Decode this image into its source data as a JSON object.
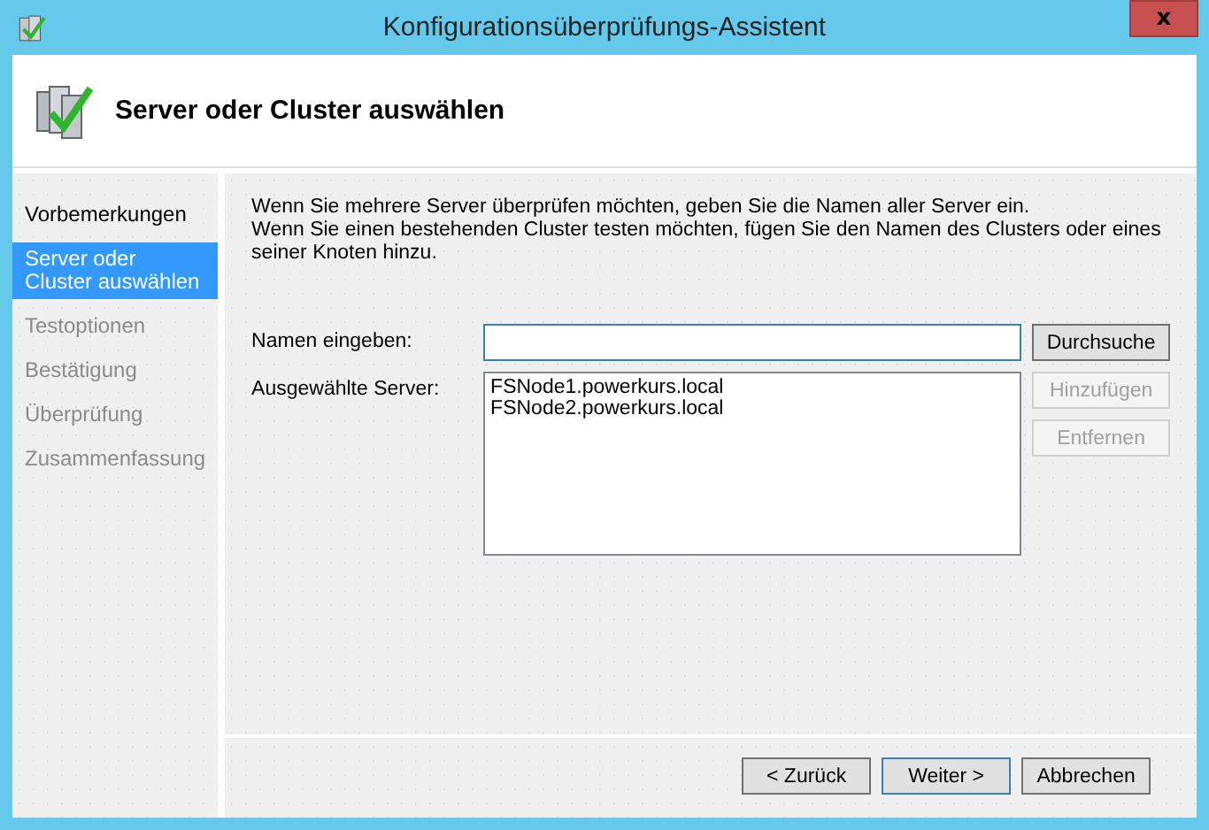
{
  "window": {
    "title": "Konfigurationsüberprüfungs-Assistent",
    "close": "x"
  },
  "header": {
    "title": "Server oder Cluster auswählen"
  },
  "nav": [
    {
      "label": "Vorbemerkungen",
      "selected": false,
      "disabled": false
    },
    {
      "label": "Server oder Cluster auswählen",
      "selected": true,
      "disabled": false
    },
    {
      "label": "Testoptionen",
      "selected": false,
      "disabled": true
    },
    {
      "label": "Bestätigung",
      "selected": false,
      "disabled": true
    },
    {
      "label": "Überprüfung",
      "selected": false,
      "disabled": true
    },
    {
      "label": "Zusammenfassung",
      "selected": false,
      "disabled": true
    }
  ],
  "intro": [
    "Wenn Sie mehrere Server überprüfen möchten, geben Sie die Namen aller Server ein.",
    "Wenn Sie einen bestehenden Cluster testen möchten, fügen Sie den Namen des Clusters oder eines seiner Knoten hinzu."
  ],
  "name_label": "Namen eingeben:",
  "browse": {
    "label": "Durchsuche",
    "disabled": false
  },
  "selected_label": "Ausgewählte Server:",
  "servers": [
    "FSNode1.powerkurs.local",
    "FSNode2.powerkurs.local"
  ],
  "side_buttons": [
    {
      "label": "Hinzufügen",
      "disabled": true
    },
    {
      "label": "Entfernen",
      "disabled": true
    }
  ],
  "footer_buttons": [
    {
      "label": "< Zurück",
      "default": false
    },
    {
      "label": "Weiter >",
      "default": true
    },
    {
      "label": "Abbrechen",
      "default": false
    }
  ]
}
